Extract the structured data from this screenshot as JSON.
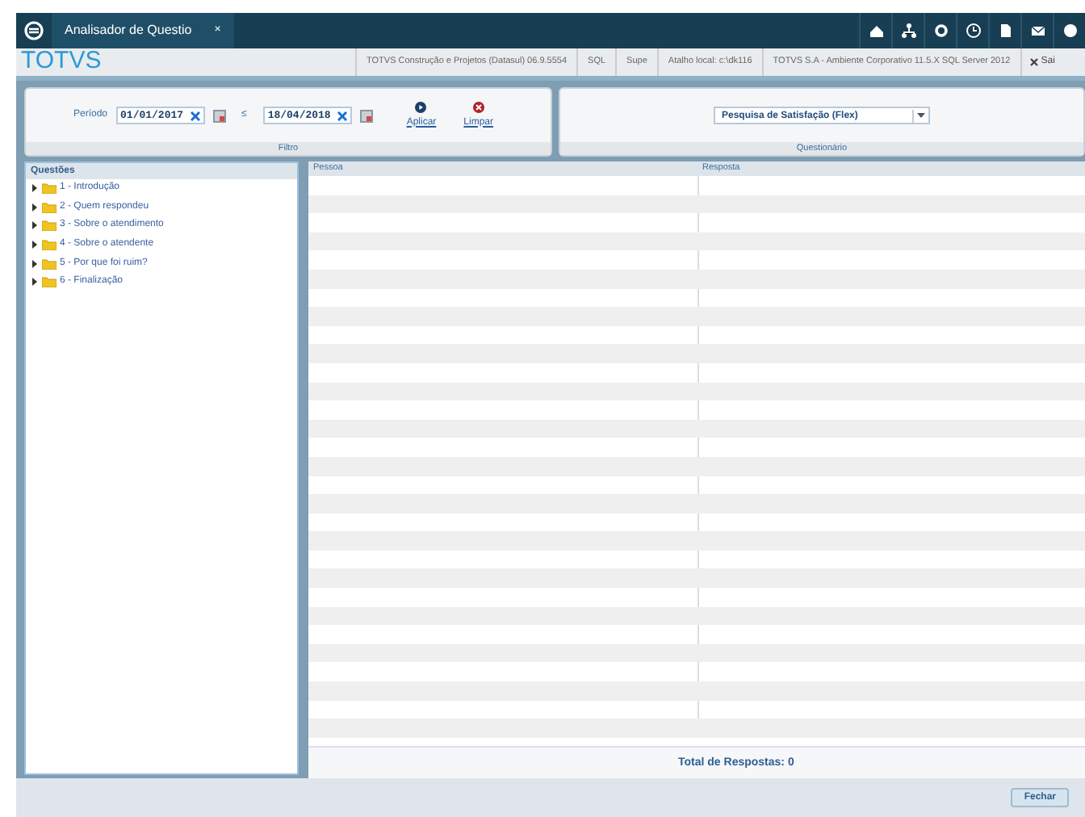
{
  "tabs": [
    {
      "label": "Analisador de Questio",
      "close": "×",
      "selected": true
    }
  ],
  "app_bar": {
    "logo": "TOTVS",
    "info": [
      "TOTVS Construção e Projetos (Datasul) 06.9.5554",
      "SQL",
      "Supe",
      "Atalho local: c:\\dk116",
      "TOTVS S.A - Ambiente Corporativo 11.5.X SQL Server 2012"
    ],
    "exit": "Sai"
  },
  "filter": {
    "period_label": "Período",
    "start": "01/01/2017",
    "separator": "≤",
    "end": "18/04/2018",
    "apply": "Aplicar",
    "clear": "Limpar",
    "legend": "Filtro"
  },
  "questionnaire": {
    "value": "Pesquisa de Satisfação (Flex)",
    "legend": "Questionário"
  },
  "tree": {
    "title": "Questões",
    "items": [
      {
        "label": "1 - Introdução",
        "expanded": false
      },
      {
        "label": "2 - Quem respondeu",
        "expanded": false
      },
      {
        "label": "3 - Sobre o atendimento",
        "expanded": false
      },
      {
        "label": "4 - Sobre o atendente",
        "expanded": false
      },
      {
        "label": "5 - Por que foi ruim?",
        "expanded": false
      },
      {
        "label": "6 - Finalização",
        "expanded": false
      }
    ]
  },
  "table": {
    "columns": [
      "Pessoa",
      "Resposta"
    ],
    "total": "Total de Respostas: 0"
  },
  "buttons": [
    "Fechar"
  ]
}
